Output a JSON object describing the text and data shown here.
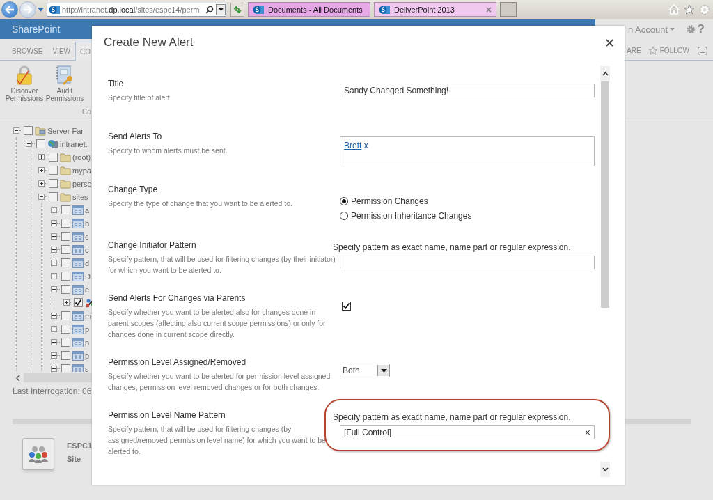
{
  "browser": {
    "address": "http://intranet.**dp.local**/sites/espc14/perm",
    "tabs": [
      {
        "label": "Documents - All Documents",
        "selected": false
      },
      {
        "label": "DeliverPoint 2013",
        "selected": true
      }
    ]
  },
  "suite_bar": {
    "brand": "SharePoint",
    "account": "n Account",
    "help": "?"
  },
  "ribbon": {
    "tabs": [
      {
        "label": "BROWSE",
        "selected": false
      },
      {
        "label": "VIEW",
        "selected": false
      },
      {
        "label": "CO",
        "selected": true
      }
    ],
    "actions": [
      "ARE",
      "FOLLOW"
    ],
    "buttons": [
      {
        "label": "Discover Permissions",
        "kind": "lock"
      },
      {
        "label": "Audit Permissions",
        "kind": "book"
      }
    ],
    "group_label": "Co"
  },
  "tree": [
    {
      "label": "Server Far",
      "kind": "farm",
      "checked": false,
      "expanded": true,
      "children": [
        {
          "label": "intranet.",
          "kind": "web",
          "checked": false,
          "expanded": true,
          "children": [
            {
              "label": "(root)",
              "kind": "folder",
              "checked": false,
              "expanded": false
            },
            {
              "label": "mypa",
              "kind": "folder",
              "checked": false,
              "expanded": false
            },
            {
              "label": "perso",
              "kind": "folder",
              "checked": false,
              "expanded": false
            },
            {
              "label": "sites",
              "kind": "folder",
              "checked": false,
              "expanded": true,
              "children": [
                {
                  "label": "a",
                  "kind": "site",
                  "checked": false,
                  "expanded": false
                },
                {
                  "label": "b",
                  "kind": "site",
                  "checked": false,
                  "expanded": false
                },
                {
                  "label": "c",
                  "kind": "site",
                  "checked": false,
                  "expanded": false
                },
                {
                  "label": "c",
                  "kind": "site",
                  "checked": false,
                  "expanded": false
                },
                {
                  "label": "d",
                  "kind": "site",
                  "checked": false,
                  "expanded": false
                },
                {
                  "label": "D",
                  "kind": "site",
                  "checked": false,
                  "expanded": false
                },
                {
                  "label": "e",
                  "kind": "site",
                  "checked": false,
                  "expanded": true,
                  "children": [
                    {
                      "kind": "subsite",
                      "checked": true,
                      "expanded": false
                    }
                  ]
                },
                {
                  "label": "m",
                  "kind": "site",
                  "checked": false,
                  "expanded": false
                },
                {
                  "label": "p",
                  "kind": "site",
                  "checked": false,
                  "expanded": false
                },
                {
                  "label": "p",
                  "kind": "site",
                  "checked": false,
                  "expanded": false
                },
                {
                  "label": "p",
                  "kind": "site",
                  "checked": false,
                  "expanded": false
                },
                {
                  "label": "s",
                  "kind": "site",
                  "checked": false,
                  "expanded": false
                }
              ]
            }
          ]
        }
      ]
    }
  ],
  "last_interrogation": "Last Interrogation: 06",
  "site_card": {
    "title": "ESPC1",
    "subtitle": "Site"
  },
  "dialog": {
    "title": "Create New Alert",
    "rows": [
      {
        "kind": "text",
        "label": "Title",
        "description": "Specify title of alert.",
        "value": "Sandy Changed Something!"
      },
      {
        "kind": "people",
        "label": "Send Alerts To",
        "description": "Specify to whom alerts must be sent.",
        "person": "Brett",
        "remove": "x"
      },
      {
        "kind": "radio",
        "label": "Change Type",
        "description": "Specify the type of change that you want to be alerted to.",
        "options": [
          {
            "label": "Permission Changes",
            "selected": true
          },
          {
            "label": "Permission Inheritance Changes",
            "selected": false
          }
        ]
      },
      {
        "kind": "pattern",
        "label": "Change Initiator Pattern",
        "description": "Specify pattern, that will be used for filtering changes (by their initiator) for which you want to be alerted to.",
        "hint": "Specify pattern as exact name, name part or regular expression.",
        "highlighted": false
      },
      {
        "kind": "checkbox",
        "label": "Send Alerts For Changes via Parents",
        "description": "Specify whether you want to be alerted also for changes done in parent scopes (affecting also current scope permissions) or only for changes done in current scope directly.",
        "checked": true
      },
      {
        "kind": "select",
        "label": "Permission Level Assigned/Removed",
        "description": "Specify whether you want to be alerted for permission level assigned changes, permission level removed changes or for both changes.",
        "value": "Both"
      },
      {
        "kind": "pattern",
        "label": "Permission Level Name Pattern",
        "description": "Specify pattern, that will be used for filtering changes (by assigned/removed permission level name) for which you want to be alerted to.",
        "hint": "Specify pattern as exact name, name part or regular expression.",
        "value": "[Full Control]",
        "clear": "×",
        "highlighted": true
      }
    ]
  }
}
